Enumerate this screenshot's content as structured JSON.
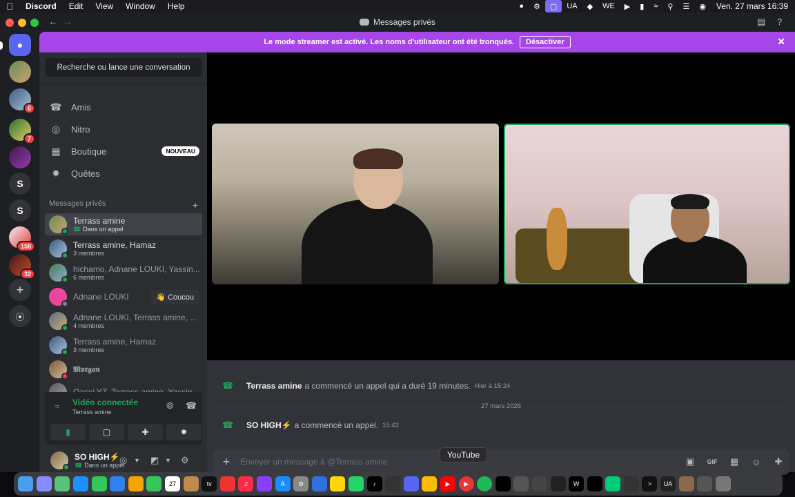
{
  "menubar": {
    "app": "Discord",
    "items": [
      "Edit",
      "View",
      "Window",
      "Help"
    ],
    "status_ua": "UA",
    "status_we": "WE",
    "clock": "Ven. 27 mars  16:39"
  },
  "window": {
    "title": "Messages privés"
  },
  "rail": {
    "server_badges": [
      "6",
      "7",
      "158",
      "32"
    ],
    "letters": [
      "S",
      "S"
    ]
  },
  "banner": {
    "text": "Le mode streamer est activé. Les noms d'utilisateur ont été tronqués.",
    "button": "Désactiver"
  },
  "sidebar": {
    "search_placeholder": "Recherche ou lance une conversation",
    "nav": [
      {
        "label": "Amis",
        "icon": "friends-icon"
      },
      {
        "label": "Nitro",
        "icon": "nitro-icon"
      },
      {
        "label": "Boutique",
        "icon": "shop-icon",
        "badge": "NOUVEAU"
      },
      {
        "label": "Quêtes",
        "icon": "quests-icon"
      }
    ],
    "dm_header": "Messages privés",
    "dms": [
      {
        "name": "Terrass amine",
        "sub": "Dans un appel",
        "selected": true
      },
      {
        "name": "Terrass amine, Hamaz",
        "sub": "3 membres"
      },
      {
        "name": "hichamo, Adnane LOUKI, Yassin...",
        "sub": "6 membres"
      },
      {
        "name": "Adnane LOUKI",
        "action": "👋 Coucou"
      },
      {
        "name": "Adnane LOUKI, Terrass amine, ...",
        "sub": "4 membres"
      },
      {
        "name": "Terrass amine, Hamaz",
        "sub": "3 membres"
      },
      {
        "name": "𝕸𝖔𝖗𝖌𝖆𝖓"
      },
      {
        "name": "Qassi YZ, Terrass amine, Yassine..."
      }
    ],
    "voice": {
      "status": "Vidéo connectée",
      "channel": "Terrass amine"
    },
    "user": {
      "name": "SO HIGH⚡",
      "status": "Dans un appel"
    }
  },
  "chat": {
    "messages": [
      {
        "author": "Terrass amine",
        "text": "a commencé un appel qui a duré 19 minutes.",
        "time": "Hier à 15:24"
      },
      {
        "author": "SO HIGH⚡",
        "text": "a commencé un appel.",
        "time": "15:43"
      }
    ],
    "date_divider": "27 mars 2026",
    "composer_placeholder": "Envoyer un message à @Terrass amine"
  },
  "tooltip": "YouTube",
  "colors": {
    "accent": "#5865f2",
    "banner": "#a646e9",
    "online": "#23a55a",
    "badge": "#f23f43"
  }
}
